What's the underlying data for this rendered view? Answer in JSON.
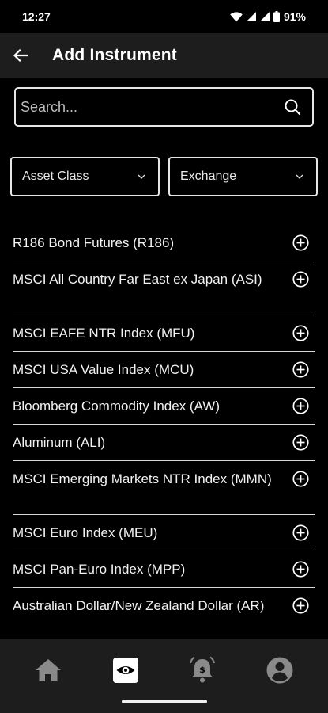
{
  "status": {
    "time": "12:27",
    "battery": "91%"
  },
  "app_bar": {
    "title": "Add Instrument"
  },
  "search": {
    "placeholder": "Search..."
  },
  "filters": {
    "asset_class": "Asset Class",
    "exchange": "Exchange"
  },
  "instruments": [
    {
      "label": "R186 Bond Futures (R186)"
    },
    {
      "label": "MSCI All Country Far East ex Japan (ASI)"
    },
    {
      "label": "MSCI EAFE NTR Index (MFU)"
    },
    {
      "label": "MSCI USA Value Index (MCU)"
    },
    {
      "label": "Bloomberg Commodity Index (AW)"
    },
    {
      "label": "Aluminum (ALI)"
    },
    {
      "label": "MSCI Emerging Markets NTR Index (MMN)"
    },
    {
      "label": "MSCI Euro Index (MEU)"
    },
    {
      "label": "MSCI Pan-Euro Index (MPP)"
    },
    {
      "label": "Australian Dollar/New Zealand Dollar (AR)"
    }
  ],
  "nav": {
    "items": [
      {
        "icon": "home-icon",
        "active": false
      },
      {
        "icon": "watchlist-eye-icon",
        "active": true
      },
      {
        "icon": "price-alert-bell-icon",
        "active": false
      },
      {
        "icon": "account-icon",
        "active": false
      }
    ]
  }
}
